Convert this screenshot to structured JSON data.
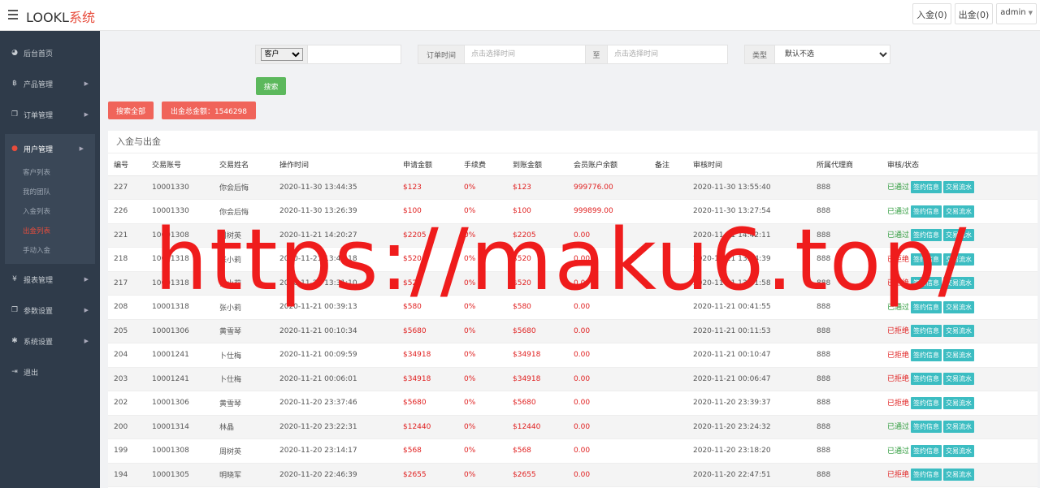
{
  "header": {
    "brand_main": "LOOKL",
    "brand_accent": "系统",
    "deposit_label": "入金(0)",
    "withdraw_label": "出金(0)",
    "user_label": "admin"
  },
  "sidebar": {
    "items": [
      {
        "label": "后台首页",
        "icon": "dashboard-icon"
      },
      {
        "label": "产品管理",
        "icon": "bitcoin-icon"
      },
      {
        "label": "订单管理",
        "icon": "copy-icon"
      },
      {
        "label": "用户管理",
        "icon": "user-icon"
      },
      {
        "label": "报表管理",
        "icon": "yen-icon"
      },
      {
        "label": "参数设置",
        "icon": "copy-icon"
      },
      {
        "label": "系统设置",
        "icon": "gears-icon"
      },
      {
        "label": "退出",
        "icon": "sign-out-icon"
      }
    ],
    "user_sub": [
      "客户列表",
      "我的团队",
      "入金列表",
      "出金列表",
      "手动入金"
    ]
  },
  "filters": {
    "customer_select": "客户",
    "order_time_label": "订单时间",
    "date_placeholder": "点击选择时间",
    "to_label": "至",
    "type_label": "类型",
    "type_select": "默认不选",
    "search_button": "搜索",
    "search_all_button": "搜索全部",
    "total_label": "出金总金额：1546298"
  },
  "panel": {
    "title": "入金与出金",
    "columns": [
      "编号",
      "交易账号",
      "交易姓名",
      "操作时间",
      "申请金额",
      "手续费",
      "到账金额",
      "会员账户余额",
      "备注",
      "审核时间",
      "所属代理商",
      "审核/状态"
    ],
    "tag_sign": "签约信息",
    "tag_flow": "交易流水",
    "rows": [
      {
        "id": "227",
        "account": "10001330",
        "name": "你会后悔",
        "op_time": "2020-11-30 13:44:35",
        "amount": "$123",
        "fee": "0%",
        "received": "$123",
        "balance": "999776.00",
        "note": "",
        "audit_time": "2020-11-30 13:55:40",
        "agent": "888",
        "status": "已通过"
      },
      {
        "id": "226",
        "account": "10001330",
        "name": "你会后悔",
        "op_time": "2020-11-30 13:26:39",
        "amount": "$100",
        "fee": "0%",
        "received": "$100",
        "balance": "999899.00",
        "note": "",
        "audit_time": "2020-11-30 13:27:54",
        "agent": "888",
        "status": "已通过"
      },
      {
        "id": "221",
        "account": "10001308",
        "name": "周树英",
        "op_time": "2020-11-21 14:20:27",
        "amount": "$2205",
        "fee": "0%",
        "received": "$2205",
        "balance": "0.00",
        "note": "",
        "audit_time": "2020-11-21 14:42:11",
        "agent": "888",
        "status": "已通过"
      },
      {
        "id": "218",
        "account": "10001318",
        "name": "张小莉",
        "op_time": "2020-11-21 13:44:18",
        "amount": "$520",
        "fee": "0%",
        "received": "$520",
        "balance": "0.00",
        "note": "",
        "audit_time": "2020-11-21 13:44:39",
        "agent": "888",
        "status": "已拒绝"
      },
      {
        "id": "217",
        "account": "10001318",
        "name": "张小莉",
        "op_time": "2020-11-21 13:31:10",
        "amount": "$520",
        "fee": "0%",
        "received": "$520",
        "balance": "0.00",
        "note": "",
        "audit_time": "2020-11-21 13:31:58",
        "agent": "888",
        "status": "已拒绝"
      },
      {
        "id": "208",
        "account": "10001318",
        "name": "张小莉",
        "op_time": "2020-11-21 00:39:13",
        "amount": "$580",
        "fee": "0%",
        "received": "$580",
        "balance": "0.00",
        "note": "",
        "audit_time": "2020-11-21 00:41:55",
        "agent": "888",
        "status": "已通过"
      },
      {
        "id": "205",
        "account": "10001306",
        "name": "黄雪琴",
        "op_time": "2020-11-21 00:10:34",
        "amount": "$5680",
        "fee": "0%",
        "received": "$5680",
        "balance": "0.00",
        "note": "",
        "audit_time": "2020-11-21 00:11:53",
        "agent": "888",
        "status": "已拒绝"
      },
      {
        "id": "204",
        "account": "10001241",
        "name": "卜仕梅",
        "op_time": "2020-11-21 00:09:59",
        "amount": "$34918",
        "fee": "0%",
        "received": "$34918",
        "balance": "0.00",
        "note": "",
        "audit_time": "2020-11-21 00:10:47",
        "agent": "888",
        "status": "已拒绝"
      },
      {
        "id": "203",
        "account": "10001241",
        "name": "卜仕梅",
        "op_time": "2020-11-21 00:06:01",
        "amount": "$34918",
        "fee": "0%",
        "received": "$34918",
        "balance": "0.00",
        "note": "",
        "audit_time": "2020-11-21 00:06:47",
        "agent": "888",
        "status": "已拒绝"
      },
      {
        "id": "202",
        "account": "10001306",
        "name": "黄雪琴",
        "op_time": "2020-11-20 23:37:46",
        "amount": "$5680",
        "fee": "0%",
        "received": "$5680",
        "balance": "0.00",
        "note": "",
        "audit_time": "2020-11-20 23:39:37",
        "agent": "888",
        "status": "已拒绝"
      },
      {
        "id": "200",
        "account": "10001314",
        "name": "林晶",
        "op_time": "2020-11-20 23:22:31",
        "amount": "$12440",
        "fee": "0%",
        "received": "$12440",
        "balance": "0.00",
        "note": "",
        "audit_time": "2020-11-20 23:24:32",
        "agent": "888",
        "status": "已通过"
      },
      {
        "id": "199",
        "account": "10001308",
        "name": "周树英",
        "op_time": "2020-11-20 23:14:17",
        "amount": "$568",
        "fee": "0%",
        "received": "$568",
        "balance": "0.00",
        "note": "",
        "audit_time": "2020-11-20 23:18:20",
        "agent": "888",
        "status": "已通过"
      },
      {
        "id": "194",
        "account": "10001305",
        "name": "明晓军",
        "op_time": "2020-11-20 22:46:39",
        "amount": "$2655",
        "fee": "0%",
        "received": "$2655",
        "balance": "0.00",
        "note": "",
        "audit_time": "2020-11-20 22:47:51",
        "agent": "888",
        "status": "已拒绝"
      }
    ]
  },
  "watermark": "https://maku6.top/",
  "colors": {
    "accent": "#e74c3c",
    "sidebar": "#2f3b4a",
    "approved": "#2b9a3a",
    "rejected": "#e02020",
    "tag": "#3cbdc2"
  }
}
